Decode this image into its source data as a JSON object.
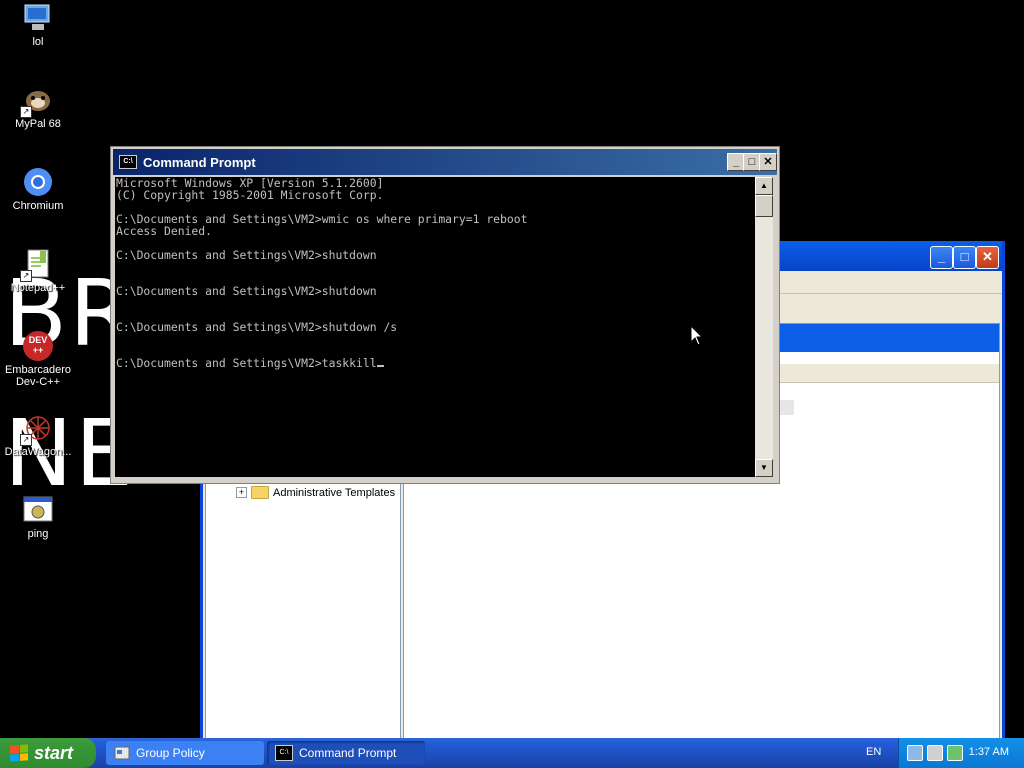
{
  "desktop": {
    "big_text_top": "BR",
    "big_text_bottom": "NE",
    "icons": [
      {
        "label": "lol",
        "icon": "computer-icon"
      },
      {
        "label": "MyPal 68",
        "icon": "mypal-browser-icon"
      },
      {
        "label": "Chromium",
        "icon": "chromium-icon"
      },
      {
        "label": "Notepad++",
        "icon": "notepad-plus-plus-icon"
      },
      {
        "label": "Embarcadero Dev-C++",
        "icon": "devcpp-icon",
        "glyph_text": "DEV\n++"
      },
      {
        "label": "DataWagon...",
        "icon": "datawagon-icon"
      },
      {
        "label": "ping",
        "icon": "ping-app-icon"
      }
    ]
  },
  "group_policy": {
    "tree_item": "Administrative Templates",
    "expander": "+",
    "buttons": {
      "minimize": "_",
      "maximize": "□",
      "close": "✕"
    }
  },
  "cmd": {
    "title": "Command Prompt",
    "icon_text": "C:\\",
    "buttons": {
      "minimize": "_",
      "maximize": "□",
      "close": "✕"
    },
    "lines": [
      "Microsoft Windows XP [Version 5.1.2600]",
      "(C) Copyright 1985-2001 Microsoft Corp.",
      "",
      "C:\\Documents and Settings\\VM2>wmic os where primary=1 reboot",
      "Access Denied.",
      "",
      "C:\\Documents and Settings\\VM2>shutdown",
      "",
      "",
      "C:\\Documents and Settings\\VM2>shutdown",
      "",
      "",
      "C:\\Documents and Settings\\VM2>shutdown /s",
      "",
      "",
      "C:\\Documents and Settings\\VM2>taskkill"
    ],
    "scroll_up": "▲",
    "scroll_down": "▼"
  },
  "taskbar": {
    "start_label": "start",
    "buttons": [
      {
        "label": "Group Policy",
        "icon": "group-policy-icon"
      },
      {
        "label": "Command Prompt",
        "icon": "cmd-icon",
        "icon_text": "C:\\"
      }
    ],
    "language": "EN",
    "clock": "1:37 AM"
  }
}
